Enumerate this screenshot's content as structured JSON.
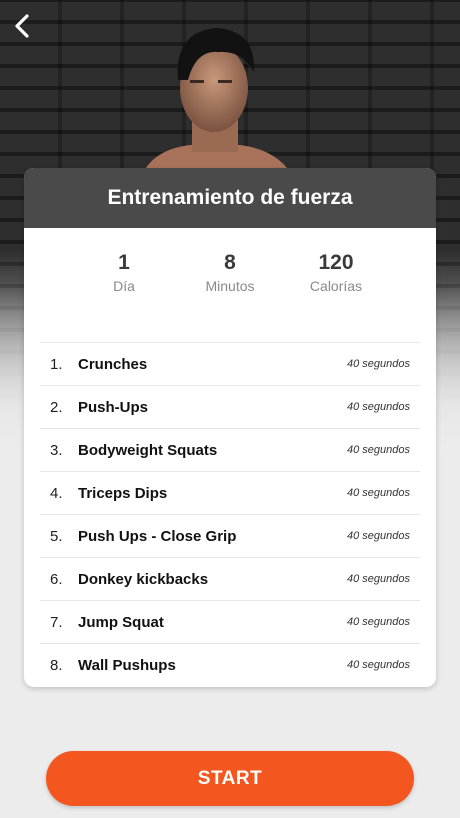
{
  "header": {
    "back_icon": "chevron-left-icon"
  },
  "card": {
    "title": "Entrenamiento de fuerza",
    "stats": [
      {
        "value": "1",
        "label": "Día"
      },
      {
        "value": "8",
        "label": "Minutos"
      },
      {
        "value": "120",
        "label": "Calorías"
      }
    ],
    "exercises": [
      {
        "num": "1.",
        "name": "Crunches",
        "duration": "40 segundos"
      },
      {
        "num": "2.",
        "name": "Push-Ups",
        "duration": "40 segundos"
      },
      {
        "num": "3.",
        "name": "Bodyweight Squats",
        "duration": "40 segundos"
      },
      {
        "num": "4.",
        "name": "Triceps Dips",
        "duration": "40 segundos"
      },
      {
        "num": "5.",
        "name": "Push Ups - Close Grip",
        "duration": "40 segundos"
      },
      {
        "num": "6.",
        "name": "Donkey kickbacks",
        "duration": "40 segundos"
      },
      {
        "num": "7.",
        "name": "Jump Squat",
        "duration": "40 segundos"
      },
      {
        "num": "8.",
        "name": "Wall Pushups",
        "duration": "40 segundos"
      }
    ]
  },
  "start_label": "START",
  "colors": {
    "accent": "#f3571f",
    "header_bg": "#4a4a4a"
  }
}
